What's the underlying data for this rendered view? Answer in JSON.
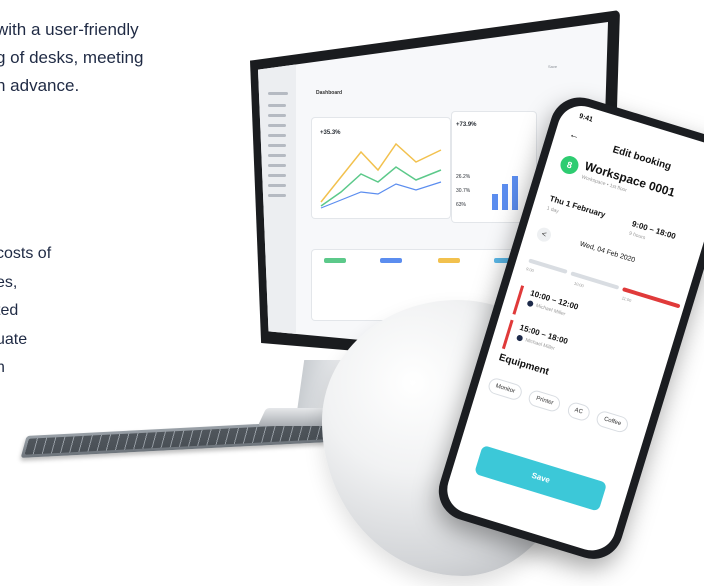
{
  "copy": {
    "top_lines": [
      "with a user-friendly",
      "g of desks, meeting",
      "n advance."
    ],
    "bottom_lines": [
      "costs of",
      "es,",
      "ted",
      "uate",
      "n"
    ]
  },
  "monitor_app": {
    "title": "Dashboard",
    "save_label": "Save",
    "kpi_main": "+35.3%",
    "kpi_side": "+73.9%",
    "stat_1": "26.2%",
    "stat_2": "30.7%",
    "stat_3": "63%"
  },
  "phone_app": {
    "time": "9:41",
    "back_glyph": "←",
    "title": "Edit booking",
    "badge": "8",
    "workspace": "Workspace 0001",
    "workspace_sub": "Workspace • 1st floor",
    "date": "Thu 1 February",
    "duration": "1 day",
    "hours": "9:00 – 18:00",
    "hours_sub": "9 hours",
    "prev_glyph": "<",
    "day": "Wed, 04 Feb 2020",
    "timeline_labels": [
      "9:00",
      "10:00",
      "11:00"
    ],
    "slots": [
      {
        "time": "10:00 – 12:00",
        "user": "Michael Miller"
      },
      {
        "time": "15:00 – 18:00",
        "user": "Michael Miller"
      }
    ],
    "equipment_title": "Equipment",
    "equipment": [
      "Monitor",
      "Printer",
      "AC",
      "Coffee"
    ],
    "save_label": "Save"
  },
  "colors": {
    "accent_cyan": "#3cc8d8",
    "badge_green": "#2ecc71",
    "booking_red": "#e03a3a",
    "text_navy": "#1f2a44"
  }
}
